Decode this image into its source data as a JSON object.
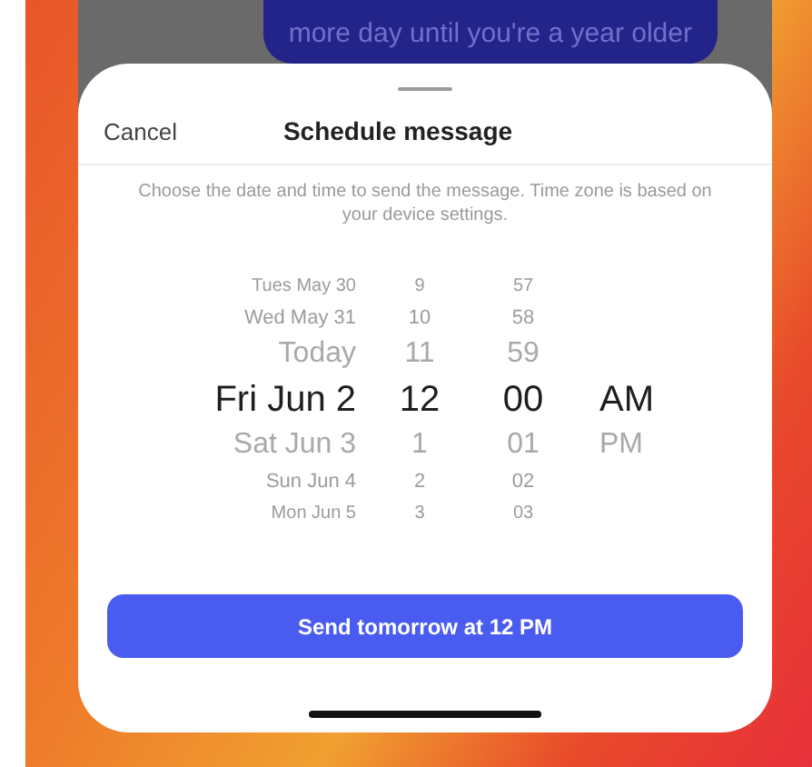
{
  "background_message": {
    "text": "more day until you're a year older"
  },
  "sheet": {
    "cancel": "Cancel",
    "title": "Schedule message",
    "description": "Choose the date and time to send the message. Time zone is based on your device settings."
  },
  "picker": {
    "columns": [
      {
        "kind": "date",
        "options": [
          {
            "label": "Tues May 30",
            "selected": false
          },
          {
            "label": "Wed May 31",
            "selected": false
          },
          {
            "label": "Today",
            "selected": false
          },
          {
            "label": "Fri Jun 2",
            "selected": true
          },
          {
            "label": "Sat Jun 3",
            "selected": false
          },
          {
            "label": "Sun Jun 4",
            "selected": false
          },
          {
            "label": "Mon Jun 5",
            "selected": false
          }
        ]
      },
      {
        "kind": "hour",
        "options": [
          {
            "label": "9",
            "selected": false
          },
          {
            "label": "10",
            "selected": false
          },
          {
            "label": "11",
            "selected": false
          },
          {
            "label": "12",
            "selected": true
          },
          {
            "label": "1",
            "selected": false
          },
          {
            "label": "2",
            "selected": false
          },
          {
            "label": "3",
            "selected": false
          }
        ]
      },
      {
        "kind": "minute",
        "options": [
          {
            "label": "57",
            "selected": false
          },
          {
            "label": "58",
            "selected": false
          },
          {
            "label": "59",
            "selected": false
          },
          {
            "label": "00",
            "selected": true
          },
          {
            "label": "01",
            "selected": false
          },
          {
            "label": "02",
            "selected": false
          },
          {
            "label": "03",
            "selected": false
          }
        ]
      },
      {
        "kind": "period",
        "options": [
          {
            "label": "AM",
            "selected": true
          },
          {
            "label": "PM",
            "selected": false
          }
        ]
      }
    ]
  },
  "send_button": {
    "label": "Send tomorrow at 12 PM"
  }
}
